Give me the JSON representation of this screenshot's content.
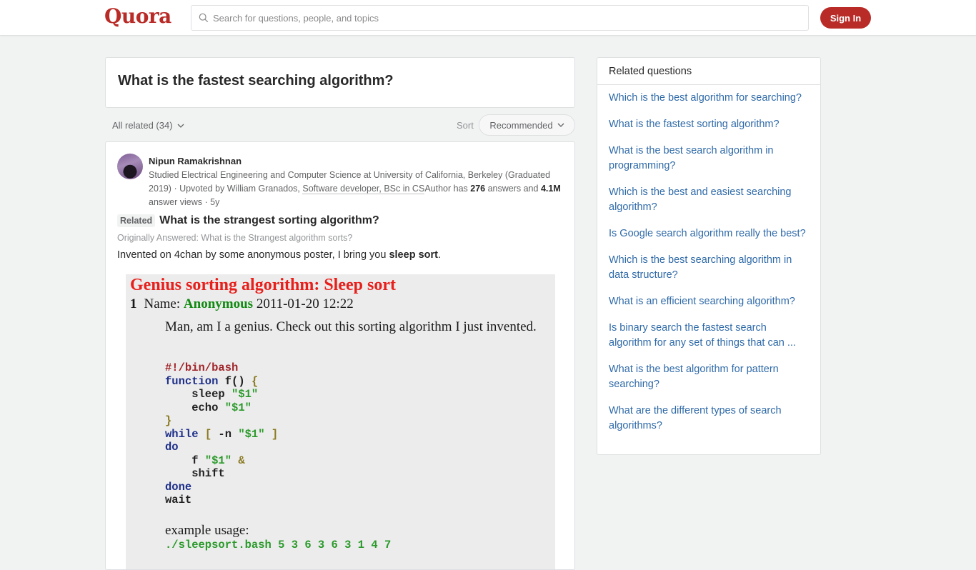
{
  "header": {
    "logo": "Quora",
    "search_placeholder": "Search for questions, people, and topics",
    "signin_label": "Sign In"
  },
  "question": {
    "title": "What is the fastest searching algorithm?"
  },
  "filters": {
    "all_related_label": "All related (34)",
    "sort_label": "Sort",
    "sort_value": "Recommended"
  },
  "answer": {
    "author": "Nipun Ramakrishnan",
    "credential_1": "Studied Electrical Engineering and Computer Science at University of California, Berkeley (Graduated 2019) · Upvoted by William Granados, ",
    "credential_link": "Software developer, BSc in CS",
    "credential_2": "Author has ",
    "answers_count": "276",
    "credential_3": " answers and ",
    "views_count": "4.1M",
    "credential_4": " answer views · 5y",
    "related_badge": "Related",
    "related_question": "What is the strangest sorting algorithm?",
    "originally_answered": "Originally Answered: What is the Strangest algorithm sorts?",
    "body_prefix": "Invented on 4chan by some anonymous poster, I bring you ",
    "body_bold": "sleep sort",
    "body_suffix": ".",
    "image": {
      "title": "Genius sorting algorithm: Sleep sort",
      "post_number": "1",
      "name_label": "Name: ",
      "name_value": "Anonymous",
      "datetime": " 2011-01-20 12:22",
      "line": "Man, am I a genius. Check out this sorting algorithm I just invented.",
      "code": {
        "shebang": "#!/bin/bash",
        "function_kw": "function",
        "function_sig": " f() ",
        "open_brace": "{",
        "sleep": "    sleep ",
        "arg": "\"$1\"",
        "echo": "    echo ",
        "close_brace": "}",
        "while_kw": "while",
        "while_cond_a": " [ ",
        "while_cond_b": "-n ",
        "while_cond_c": " ]",
        "do_kw": "do",
        "call": "    f ",
        "amp": " &",
        "shift": "    shift",
        "done_kw": "done",
        "wait": "wait"
      },
      "usage_label": "example usage:",
      "usage_cmd": "./sleepsort.bash 5 3 6 3 6 3 1 4 7"
    }
  },
  "sidebar": {
    "title": "Related questions",
    "items": [
      "Which is the best algorithm for searching?",
      "What is the fastest sorting algorithm?",
      "What is the best search algorithm in programming?",
      "Which is the best and easiest searching algorithm?",
      "Is Google search algorithm really the best?",
      "Which is the best searching algorithm in data structure?",
      "What is an efficient searching algorithm?",
      "Is binary search the fastest search algorithm for any set of things that can ...",
      "What is the best algorithm for pattern searching?",
      "What are the different types of search algorithms?"
    ]
  }
}
